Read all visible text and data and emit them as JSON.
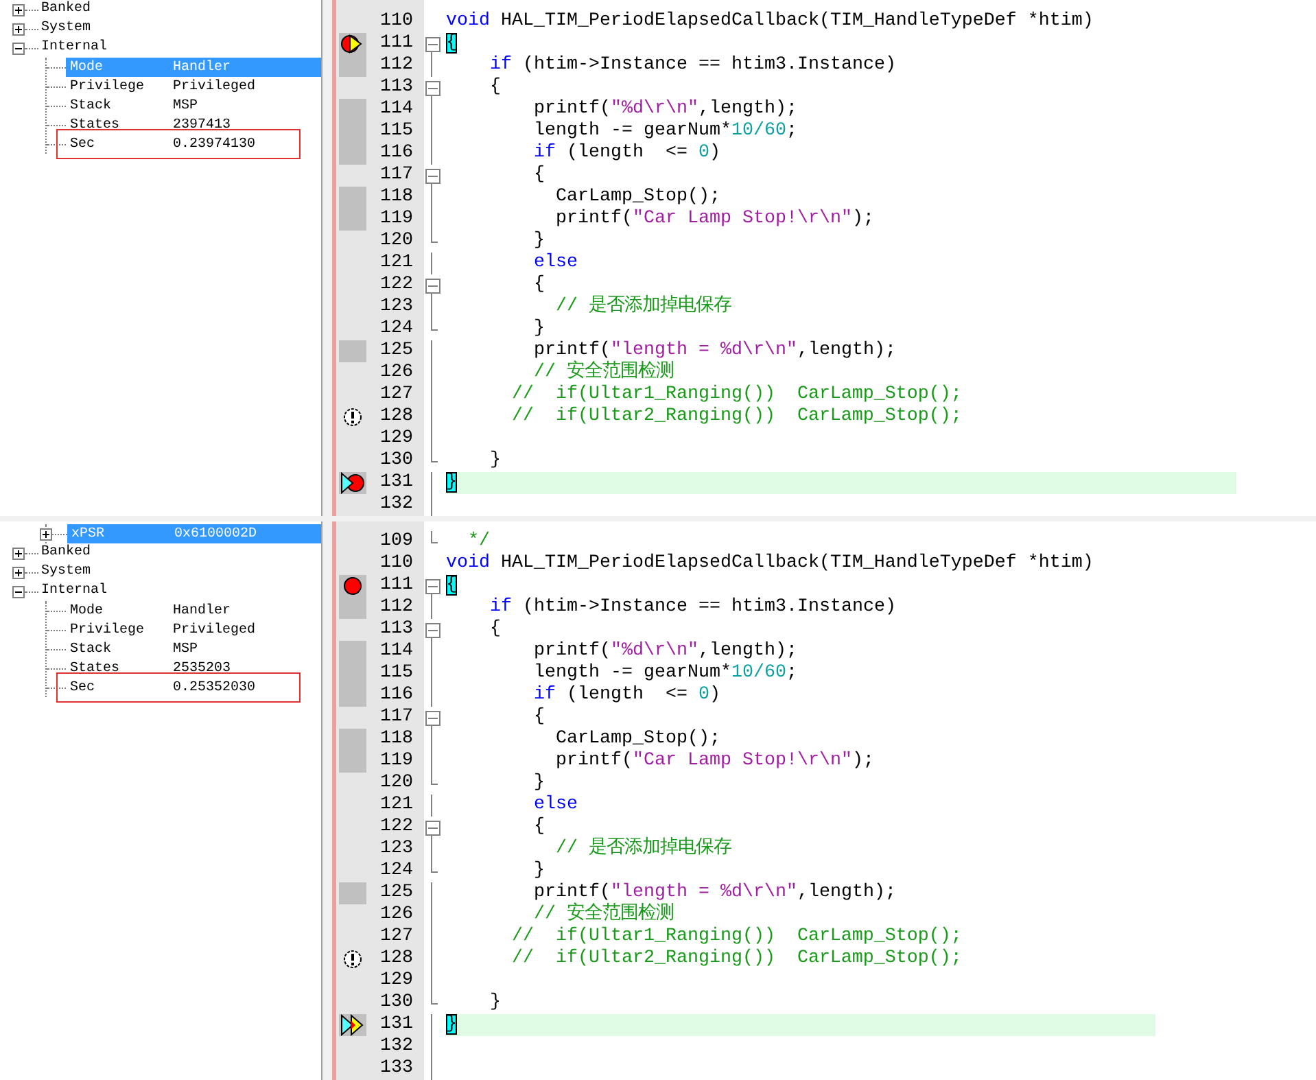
{
  "panes": [
    {
      "registers": {
        "rows": [
          {
            "name": "Banked",
            "expanded": false,
            "selected": false
          },
          {
            "name": "System",
            "expanded": false,
            "selected": false
          },
          {
            "name": "Internal",
            "expanded": true,
            "selected": false,
            "children": [
              {
                "name": "Mode",
                "value": "Handler",
                "selected": true,
                "outlined": false
              },
              {
                "name": "Privilege",
                "value": "Privileged",
                "selected": false,
                "outlined": false
              },
              {
                "name": "Stack",
                "value": "MSP",
                "selected": false,
                "outlined": false
              },
              {
                "name": "States",
                "value": "2397413",
                "selected": false,
                "outlined": false
              },
              {
                "name": "Sec",
                "value": "0.23974130",
                "selected": false,
                "outlined": true
              }
            ]
          }
        ]
      },
      "editor": {
        "lines": [
          {
            "number": "110",
            "executed": false,
            "in_block": false,
            "foldable": false,
            "block_end": false,
            "current": false,
            "tokens": [
              {
                "kind": "keyword",
                "text": "void"
              },
              {
                "kind": "plain",
                "text": " HAL_TIM_PeriodElapsedCallback(TIM_HandleTypeDef *htim)"
              }
            ]
          },
          {
            "number": "111",
            "executed": true,
            "marker": {
              "kind": "breakpoint-current"
            },
            "in_block": true,
            "foldable": true,
            "block_end": false,
            "current": false,
            "tokens": [
              {
                "kind": "match",
                "text": "{"
              }
            ]
          },
          {
            "number": "112",
            "executed": true,
            "in_block": true,
            "foldable": false,
            "block_end": false,
            "current": false,
            "tokens": [
              {
                "kind": "keyword",
                "text": "    if"
              },
              {
                "kind": "plain",
                "text": " (htim->Instance == htim3.Instance)"
              }
            ]
          },
          {
            "number": "113",
            "executed": false,
            "in_block": true,
            "foldable": true,
            "block_end": false,
            "current": false,
            "tokens": [
              {
                "kind": "plain",
                "text": "    {"
              }
            ]
          },
          {
            "number": "114",
            "executed": true,
            "in_block": true,
            "foldable": false,
            "block_end": false,
            "current": false,
            "tokens": [
              {
                "kind": "plain",
                "text": "        printf("
              },
              {
                "kind": "string",
                "text": "\"%d\\r\\n\""
              },
              {
                "kind": "plain",
                "text": ",length);"
              }
            ]
          },
          {
            "number": "115",
            "executed": true,
            "in_block": true,
            "foldable": false,
            "block_end": false,
            "current": false,
            "tokens": [
              {
                "kind": "plain",
                "text": "        length -= gearNum*"
              },
              {
                "kind": "number",
                "text": "10/60"
              },
              {
                "kind": "plain",
                "text": ";"
              }
            ]
          },
          {
            "number": "116",
            "executed": true,
            "in_block": true,
            "foldable": false,
            "block_end": false,
            "current": false,
            "tokens": [
              {
                "kind": "keyword",
                "text": "        if"
              },
              {
                "kind": "plain",
                "text": " (length  <= "
              },
              {
                "kind": "number",
                "text": "0"
              },
              {
                "kind": "plain",
                "text": ")"
              }
            ]
          },
          {
            "number": "117",
            "executed": false,
            "in_block": true,
            "foldable": true,
            "block_end": false,
            "current": false,
            "tokens": [
              {
                "kind": "plain",
                "text": "        {"
              }
            ]
          },
          {
            "number": "118",
            "executed": true,
            "in_block": true,
            "foldable": false,
            "block_end": false,
            "current": false,
            "tokens": [
              {
                "kind": "plain",
                "text": "          CarLamp_Stop();"
              }
            ]
          },
          {
            "number": "119",
            "executed": true,
            "in_block": true,
            "foldable": false,
            "block_end": false,
            "current": false,
            "tokens": [
              {
                "kind": "plain",
                "text": "          printf("
              },
              {
                "kind": "string",
                "text": "\"Car Lamp Stop!\\r\\n\""
              },
              {
                "kind": "plain",
                "text": ");"
              }
            ]
          },
          {
            "number": "120",
            "executed": false,
            "in_block": true,
            "foldable": false,
            "block_end": true,
            "current": false,
            "tokens": [
              {
                "kind": "plain",
                "text": "        }"
              }
            ]
          },
          {
            "number": "121",
            "executed": false,
            "in_block": true,
            "foldable": false,
            "block_end": false,
            "current": false,
            "tokens": [
              {
                "kind": "keyword",
                "text": "        else"
              }
            ]
          },
          {
            "number": "122",
            "executed": false,
            "in_block": true,
            "foldable": true,
            "block_end": false,
            "current": false,
            "tokens": [
              {
                "kind": "plain",
                "text": "        {"
              }
            ]
          },
          {
            "number": "123",
            "executed": false,
            "in_block": true,
            "foldable": false,
            "block_end": false,
            "current": false,
            "tokens": [
              {
                "kind": "comment",
                "text": "          // 是否添加掉电保存"
              }
            ]
          },
          {
            "number": "124",
            "executed": false,
            "in_block": true,
            "foldable": false,
            "block_end": true,
            "current": false,
            "tokens": [
              {
                "kind": "plain",
                "text": "        }"
              }
            ]
          },
          {
            "number": "125",
            "executed": true,
            "in_block": true,
            "foldable": false,
            "block_end": false,
            "current": false,
            "tokens": [
              {
                "kind": "plain",
                "text": "        printf("
              },
              {
                "kind": "string",
                "text": "\"length = %d\\r\\n\""
              },
              {
                "kind": "plain",
                "text": ",length);"
              }
            ]
          },
          {
            "number": "126",
            "executed": false,
            "in_block": true,
            "foldable": false,
            "block_end": false,
            "current": false,
            "tokens": [
              {
                "kind": "comment",
                "text": "        // 安全范围检测"
              }
            ]
          },
          {
            "number": "127",
            "executed": false,
            "in_block": true,
            "foldable": false,
            "block_end": false,
            "current": false,
            "tokens": [
              {
                "kind": "comment",
                "text": "      //  if(Ultar1_Ranging())  CarLamp_Stop();"
              }
            ]
          },
          {
            "number": "128",
            "executed": false,
            "marker": {
              "kind": "warning"
            },
            "in_block": true,
            "foldable": false,
            "block_end": false,
            "current": false,
            "tokens": [
              {
                "kind": "comment",
                "text": "      //  if(Ultar2_Ranging())  CarLamp_Stop();"
              }
            ]
          },
          {
            "number": "129",
            "executed": false,
            "in_block": true,
            "foldable": false,
            "block_end": false,
            "current": false
          },
          {
            "number": "130",
            "executed": false,
            "in_block": true,
            "foldable": false,
            "block_end": true,
            "current": false,
            "tokens": [
              {
                "kind": "plain",
                "text": "    }"
              }
            ]
          },
          {
            "number": "131",
            "executed": true,
            "marker": {
              "kind": "arrow-breakpoint"
            },
            "in_block": true,
            "foldable": false,
            "block_end": false,
            "current": true,
            "tokens": [
              {
                "kind": "match",
                "text": "}"
              }
            ]
          },
          {
            "number": "132",
            "executed": false,
            "in_block": true,
            "foldable": false,
            "block_end": false,
            "current": false
          }
        ]
      }
    },
    {
      "registers": {
        "continued": [
          {
            "name": "xPSR",
            "value": "0x6100002D",
            "expanded": false,
            "selected": true
          }
        ],
        "rows": [
          {
            "name": "Banked",
            "expanded": false,
            "selected": false
          },
          {
            "name": "System",
            "expanded": false,
            "selected": false
          },
          {
            "name": "Internal",
            "expanded": true,
            "selected": false,
            "children": [
              {
                "name": "Mode",
                "value": "Handler",
                "selected": false,
                "outlined": false
              },
              {
                "name": "Privilege",
                "value": "Privileged",
                "selected": false,
                "outlined": false
              },
              {
                "name": "Stack",
                "value": "MSP",
                "selected": false,
                "outlined": false
              },
              {
                "name": "States",
                "value": "2535203",
                "selected": false,
                "outlined": false
              },
              {
                "name": "Sec",
                "value": "0.25352030",
                "selected": false,
                "outlined": true
              }
            ]
          }
        ]
      },
      "editor": {
        "lines": [
          {
            "number": "109",
            "executed": false,
            "in_block": true,
            "foldable": false,
            "block_end": true,
            "current": false,
            "tokens": [
              {
                "kind": "comment",
                "text": "  */"
              }
            ]
          },
          {
            "number": "110",
            "executed": false,
            "in_block": false,
            "foldable": false,
            "block_end": false,
            "current": false,
            "tokens": [
              {
                "kind": "keyword",
                "text": "void"
              },
              {
                "kind": "plain",
                "text": " HAL_TIM_PeriodElapsedCallback(TIM_HandleTypeDef *htim)"
              }
            ]
          },
          {
            "number": "111",
            "executed": true,
            "marker": {
              "kind": "breakpoint"
            },
            "in_block": true,
            "foldable": true,
            "block_end": false,
            "current": false,
            "tokens": [
              {
                "kind": "match",
                "text": "{"
              }
            ]
          },
          {
            "number": "112",
            "executed": true,
            "in_block": true,
            "foldable": false,
            "block_end": false,
            "current": false,
            "tokens": [
              {
                "kind": "keyword",
                "text": "    if"
              },
              {
                "kind": "plain",
                "text": " (htim->Instance == htim3.Instance)"
              }
            ]
          },
          {
            "number": "113",
            "executed": false,
            "in_block": true,
            "foldable": true,
            "block_end": false,
            "current": false,
            "tokens": [
              {
                "kind": "plain",
                "text": "    {"
              }
            ]
          },
          {
            "number": "114",
            "executed": true,
            "in_block": true,
            "foldable": false,
            "block_end": false,
            "current": false,
            "tokens": [
              {
                "kind": "plain",
                "text": "        printf("
              },
              {
                "kind": "string",
                "text": "\"%d\\r\\n\""
              },
              {
                "kind": "plain",
                "text": ",length);"
              }
            ]
          },
          {
            "number": "115",
            "executed": true,
            "in_block": true,
            "foldable": false,
            "block_end": false,
            "current": false,
            "tokens": [
              {
                "kind": "plain",
                "text": "        length -= gearNum*"
              },
              {
                "kind": "number",
                "text": "10/60"
              },
              {
                "kind": "plain",
                "text": ";"
              }
            ]
          },
          {
            "number": "116",
            "executed": true,
            "in_block": true,
            "foldable": false,
            "block_end": false,
            "current": false,
            "tokens": [
              {
                "kind": "keyword",
                "text": "        if"
              },
              {
                "kind": "plain",
                "text": " (length  <= "
              },
              {
                "kind": "number",
                "text": "0"
              },
              {
                "kind": "plain",
                "text": ")"
              }
            ]
          },
          {
            "number": "117",
            "executed": false,
            "in_block": true,
            "foldable": true,
            "block_end": false,
            "current": false,
            "tokens": [
              {
                "kind": "plain",
                "text": "        {"
              }
            ]
          },
          {
            "number": "118",
            "executed": true,
            "in_block": true,
            "foldable": false,
            "block_end": false,
            "current": false,
            "tokens": [
              {
                "kind": "plain",
                "text": "          CarLamp_Stop();"
              }
            ]
          },
          {
            "number": "119",
            "executed": true,
            "in_block": true,
            "foldable": false,
            "block_end": false,
            "current": false,
            "tokens": [
              {
                "kind": "plain",
                "text": "          printf("
              },
              {
                "kind": "string",
                "text": "\"Car Lamp Stop!\\r\\n\""
              },
              {
                "kind": "plain",
                "text": ");"
              }
            ]
          },
          {
            "number": "120",
            "executed": false,
            "in_block": true,
            "foldable": false,
            "block_end": true,
            "current": false,
            "tokens": [
              {
                "kind": "plain",
                "text": "        }"
              }
            ]
          },
          {
            "number": "121",
            "executed": false,
            "in_block": true,
            "foldable": false,
            "block_end": false,
            "current": false,
            "tokens": [
              {
                "kind": "keyword",
                "text": "        else"
              }
            ]
          },
          {
            "number": "122",
            "executed": false,
            "in_block": true,
            "foldable": true,
            "block_end": false,
            "current": false,
            "tokens": [
              {
                "kind": "plain",
                "text": "        {"
              }
            ]
          },
          {
            "number": "123",
            "executed": false,
            "in_block": true,
            "foldable": false,
            "block_end": false,
            "current": false,
            "tokens": [
              {
                "kind": "comment",
                "text": "          // 是否添加掉电保存"
              }
            ]
          },
          {
            "number": "124",
            "executed": false,
            "in_block": true,
            "foldable": false,
            "block_end": true,
            "current": false,
            "tokens": [
              {
                "kind": "plain",
                "text": "        }"
              }
            ]
          },
          {
            "number": "125",
            "executed": true,
            "in_block": true,
            "foldable": false,
            "block_end": false,
            "current": false,
            "tokens": [
              {
                "kind": "plain",
                "text": "        printf("
              },
              {
                "kind": "string",
                "text": "\"length = %d\\r\\n\""
              },
              {
                "kind": "plain",
                "text": ",length);"
              }
            ]
          },
          {
            "number": "126",
            "executed": false,
            "in_block": true,
            "foldable": false,
            "block_end": false,
            "current": false,
            "tokens": [
              {
                "kind": "comment",
                "text": "        // 安全范围检测"
              }
            ]
          },
          {
            "number": "127",
            "executed": false,
            "in_block": true,
            "foldable": false,
            "block_end": false,
            "current": false,
            "tokens": [
              {
                "kind": "comment",
                "text": "      //  if(Ultar1_Ranging())  CarLamp_Stop();"
              }
            ]
          },
          {
            "number": "128",
            "executed": false,
            "marker": {
              "kind": "warning"
            },
            "in_block": true,
            "foldable": false,
            "block_end": false,
            "current": false,
            "tokens": [
              {
                "kind": "comment",
                "text": "      //  if(Ultar2_Ranging())  CarLamp_Stop();"
              }
            ]
          },
          {
            "number": "129",
            "executed": false,
            "in_block": true,
            "foldable": false,
            "block_end": false,
            "current": false
          },
          {
            "number": "130",
            "executed": false,
            "in_block": true,
            "foldable": false,
            "block_end": true,
            "current": false,
            "tokens": [
              {
                "kind": "plain",
                "text": "    }"
              }
            ]
          },
          {
            "number": "131",
            "executed": true,
            "marker": {
              "kind": "double-arrow"
            },
            "in_block": true,
            "foldable": false,
            "block_end": false,
            "current": true,
            "tokens": [
              {
                "kind": "match",
                "text": "}"
              }
            ]
          },
          {
            "number": "132",
            "executed": false,
            "in_block": true,
            "foldable": false,
            "block_end": false,
            "current": false
          },
          {
            "number": "133",
            "executed": false,
            "in_block": true,
            "foldable": false,
            "block_end": false,
            "current": false
          }
        ]
      }
    }
  ]
}
